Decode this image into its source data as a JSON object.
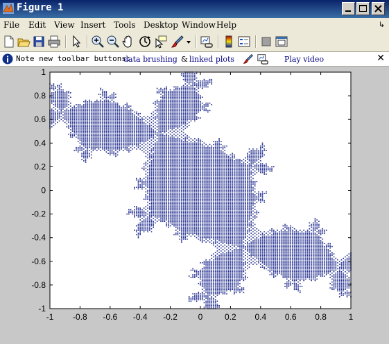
{
  "window": {
    "title": "Figure 1"
  },
  "menu": {
    "items": [
      "File",
      "Edit",
      "View",
      "Insert",
      "Tools",
      "Desktop",
      "Window",
      "Help"
    ]
  },
  "infobar": {
    "message": "Note new toolbar buttons:",
    "link_brushing": "data brushing",
    "amp": "&",
    "link_plots": "linked plots",
    "link_video": "Play video"
  },
  "colors": {
    "titlebar": "#0a246a",
    "plot_marker": "#1e2a8c"
  },
  "chart_data": {
    "type": "scatter",
    "title": "",
    "xlabel": "",
    "ylabel": "",
    "xlim": [
      -1,
      1
    ],
    "ylim": [
      -1,
      1
    ],
    "xticks": [
      "-1",
      "-0.8",
      "-0.6",
      "-0.4",
      "-0.2",
      "0",
      "0.2",
      "0.4",
      "0.6",
      "0.8",
      "1"
    ],
    "yticks": [
      "1",
      "0.8",
      "0.6",
      "0.4",
      "0.2",
      "0",
      "-0.2",
      "-0.4",
      "-0.6",
      "-0.8",
      "-1"
    ],
    "marker": ".",
    "grid": false,
    "series": [
      {
        "clusters": [
          {
            "x": -0.3,
            "y": 0.38,
            "rx": 0.16,
            "ry": 0.17,
            "fill": "dense"
          },
          {
            "x": 0.28,
            "y": -0.38,
            "rx": 0.16,
            "ry": 0.17,
            "fill": "dense"
          },
          {
            "x": -0.05,
            "y": 0.85,
            "rx": 0.05,
            "ry": 0.04,
            "fill": "medium"
          },
          {
            "x": 0.05,
            "y": -0.85,
            "rx": 0.05,
            "ry": 0.04,
            "fill": "medium"
          },
          {
            "x": 0.43,
            "y": 0.22,
            "rx": 0.05,
            "ry": 0.04,
            "fill": "medium"
          },
          {
            "x": -0.43,
            "y": -0.2,
            "rx": 0.05,
            "ry": 0.04,
            "fill": "medium"
          },
          {
            "x": -0.85,
            "y": 0.27,
            "rx": 0.04,
            "ry": 0.04,
            "fill": "sparse"
          },
          {
            "x": 0.85,
            "y": -0.28,
            "rx": 0.04,
            "ry": 0.04,
            "fill": "sparse"
          }
        ]
      }
    ]
  }
}
